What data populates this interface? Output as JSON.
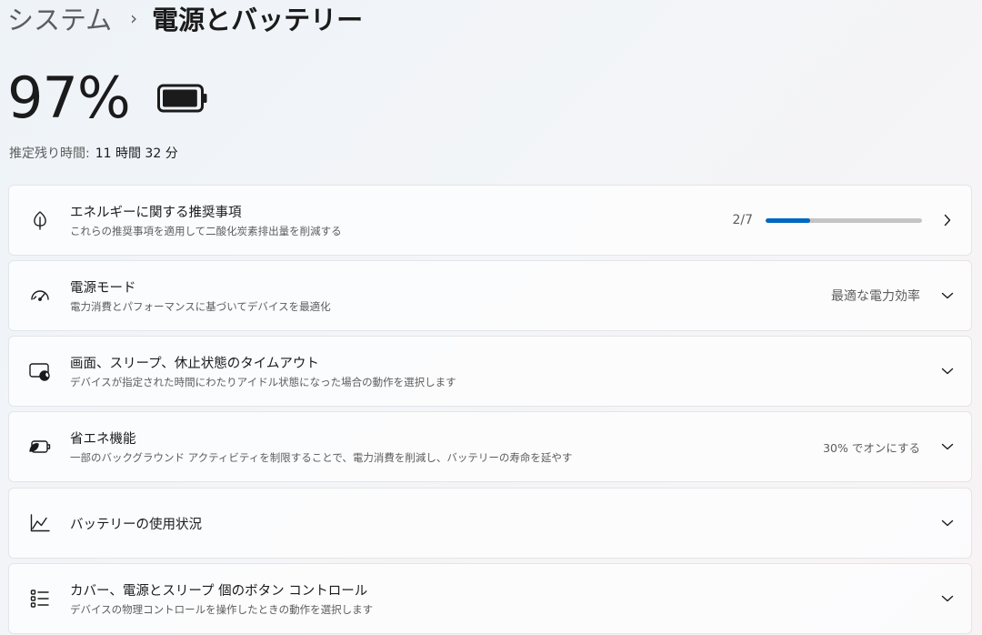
{
  "breadcrumb": {
    "parent": "システム",
    "separator": "›",
    "current": "電源とバッテリー"
  },
  "battery": {
    "percent_label": "97%",
    "percent": 97,
    "remaining_label": "推定残り時間:",
    "remaining_value": "11 時間 32 分"
  },
  "cards": {
    "energy": {
      "title": "エネルギーに関する推奨事項",
      "desc": "これらの推奨事項を適用して二酸化炭素排出量を削減する",
      "progress_label": "2/7",
      "progress_fraction": 0.2857,
      "icon": "leaf-icon"
    },
    "power_mode": {
      "title": "電源モード",
      "desc": "電力消費とパフォーマンスに基づいてデバイスを最適化",
      "value": "最適な電力効率",
      "icon": "gauge-icon"
    },
    "screen_sleep": {
      "title": "画面、スリープ、休止状態のタイムアウト",
      "desc": "デバイスが指定された時間にわたりアイドル状態になった場合の動作を選択します",
      "icon": "screen-sleep-icon"
    },
    "energy_saver": {
      "title": "省エネ機能",
      "desc": "一部のバックグラウンド アクティビティを制限することで、電力消費を削減し、バッテリーの寿命を延やす",
      "value": "30% でオンにする",
      "icon": "battery-saver-icon"
    },
    "battery_usage": {
      "title": "バッテリーの使用状況",
      "icon": "chart-icon"
    },
    "lid_buttons": {
      "title": "カバー、電源とスリープ 個のボタン コントロール",
      "desc": "デバイスの物理コントロールを操作したときの動作を選択します",
      "icon": "list-icon"
    }
  },
  "colors": {
    "accent": "#0067c0",
    "track": "#c5c5c5"
  }
}
